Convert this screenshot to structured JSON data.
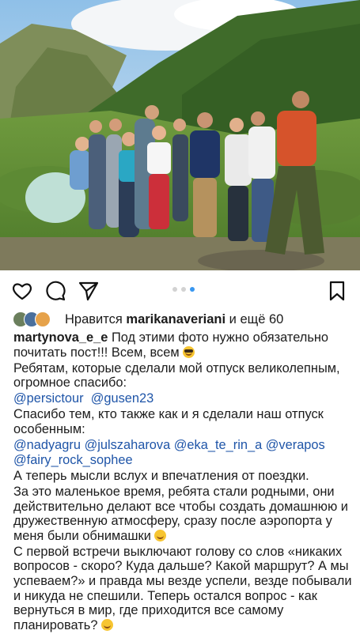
{
  "post": {
    "image_description_icon": "group-photo",
    "carousel": {
      "total": 3,
      "active_index": 2
    },
    "likes": {
      "prefix": "Нравится",
      "user": "marikanaveriani",
      "suffix": "и ещё 60"
    },
    "caption": {
      "username": "martynova_e_e",
      "lines": [
        {
          "text": "Под этими фото нужно обязательно почитать пост!!! Всем, всем",
          "emoji": "smiling-face-with-sunglasses"
        },
        {
          "text": "Ребятам, которые сделали мой отпуск великолепным, огромное спасибо:"
        },
        {
          "mentions": [
            "@persictour",
            "@gusen23"
          ]
        },
        {
          "text": "Спасибо тем, кто также как и я сделали наш отпуск особенным:"
        },
        {
          "mentions": [
            "@nadyagru",
            "@julszaharova",
            "@eka_te_rin_a",
            "@verapos",
            "@fairy_rock_sophee"
          ]
        },
        {
          "text": "А теперь мысли вслух и впечатления от поездки."
        },
        {
          "text": "За это маленькое время, ребята стали родными, они действительно делают все чтобы создать домашнюю и дружественную атмосферу, сразу после аэропорта у меня были обнимашки",
          "emoji": "smiling-face"
        },
        {
          "text": "С первой встречи выключают голову со слов «никаких вопросов - скоро? Куда дальше? Какой маршрут? А мы успеваем?» и правда мы везде успели, везде побывали и никуда не спешили. Теперь остался вопрос - как вернуться в мир, где приходится все самому планировать?",
          "emoji": "face-with-tears-of-joy"
        }
      ]
    },
    "colors": {
      "mention": "#1f55a8",
      "dot_active": "#3897f0",
      "dot_inactive": "#d2d2d2"
    }
  }
}
